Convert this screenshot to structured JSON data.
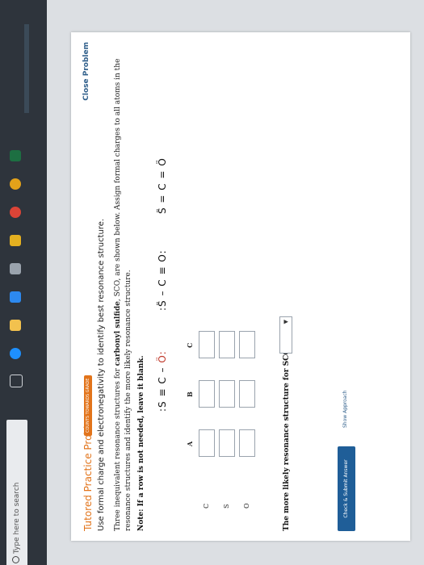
{
  "taskbar": {
    "search_placeholder": "Type here to search",
    "icons": [
      "search-icon",
      "windows-icon",
      "task-view-icon",
      "edge-icon",
      "file-explorer-icon",
      "store-icon",
      "mail-icon",
      "chrome-icon",
      "excel-icon"
    ]
  },
  "problem": {
    "title": "Tutored Practice Problem 6.3.3",
    "badge": "COUNTS TOWARDS GRADE",
    "close_label": "Close Problem",
    "subtitle": "Use formal charge and electronegativity to identify best resonance structure.",
    "intro_pre": "Three inequivalent resonance structures for ",
    "intro_bold": "carbonyl sulfide",
    "intro_post": ", SCO, are shown below. Assign formal charges to all atoms in the resonance structures and identify the more likely resonance structure.",
    "note": "Note: If a row is not needed, leave it blank."
  },
  "structures": {
    "a": {
      "left": ":S ≡ C – ",
      "right": "Ö:"
    },
    "b": {
      "left": ":S̈ – C ≡ O:"
    },
    "c": {
      "left": "S̈ = C = ",
      "right": "Ö"
    }
  },
  "columns": [
    "A",
    "B",
    "C"
  ],
  "rows": [
    "C",
    "S",
    "O"
  ],
  "likely": {
    "label": "The more likely resonance structure for SCO is",
    "arrow": "▼"
  },
  "actions": {
    "submit_label": "Check & Submit Answer",
    "approach_label": "Show Approach"
  },
  "colors": {
    "accent": "#e2741b",
    "button": "#1f5e98"
  }
}
